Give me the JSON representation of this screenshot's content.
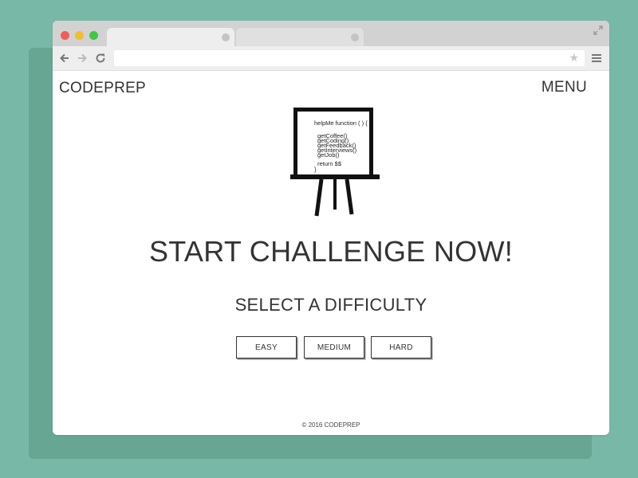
{
  "browser": {
    "tabs": [
      {
        "title": ""
      },
      {
        "title": ""
      }
    ],
    "address_bar": {
      "value": ""
    },
    "icons": {
      "back": "arrow-left-icon",
      "forward": "arrow-right-icon",
      "reload": "reload-icon",
      "bookmark": "star-icon",
      "menu": "hamburger-menu-icon",
      "expand": "expand-icon"
    },
    "star_glyph": "★",
    "colors": {
      "titlebar": "#d2d2d2",
      "toolbar": "#eeeeee",
      "close": "#ef5f57",
      "minimize": "#f2be2d",
      "maximize": "#3cc843"
    }
  },
  "site": {
    "logo": "CODEPREP",
    "menu_label": "MENU",
    "illustration": {
      "icon": "easel-whiteboard-icon",
      "code_lines": [
        "helpMe function ( ) {",
        "getCoffee()",
        "getCoding()",
        "getFeedback()",
        "getInterviews()",
        "getJob()",
        "return $$",
        "}"
      ]
    },
    "headline": "START CHALLENGE NOW!",
    "subheadline": "SELECT A DIFFICULTY",
    "buttons": {
      "easy": "EASY",
      "medium": "MEDIUM",
      "hard": "HARD"
    },
    "footer": "© 2016 CODEPREP"
  },
  "colors": {
    "background": "#78b8a6",
    "text": "#333333"
  }
}
